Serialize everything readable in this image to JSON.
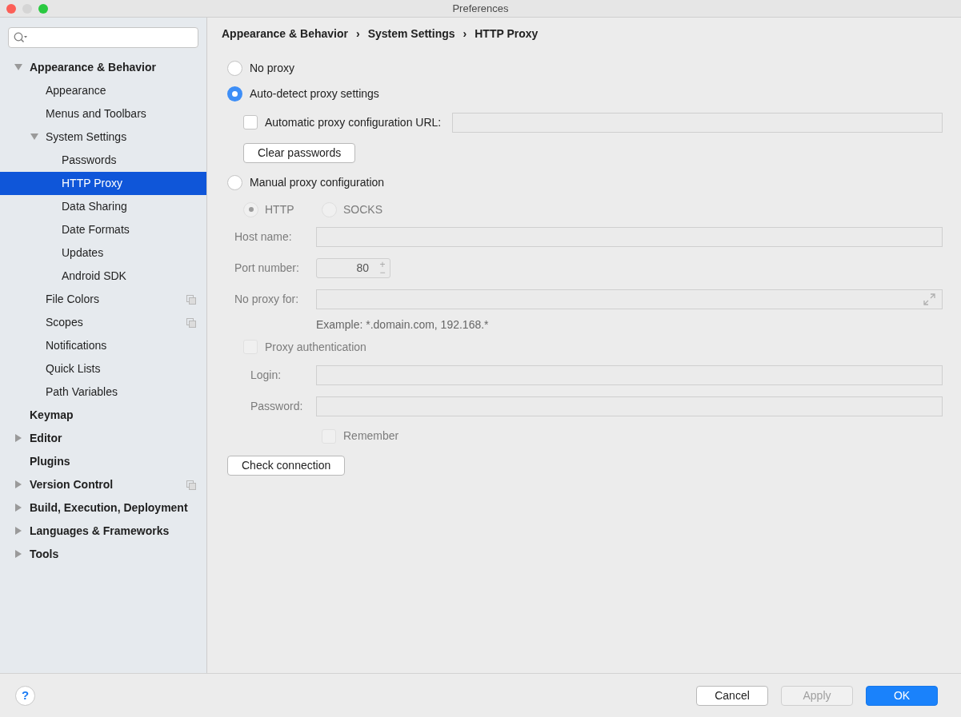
{
  "window": {
    "title": "Preferences"
  },
  "sidebar": {
    "items": [
      {
        "label": "Appearance & Behavior",
        "expanded": true,
        "selected": false,
        "shared": false,
        "children": [
          {
            "label": "Appearance",
            "selected": false,
            "shared": false
          },
          {
            "label": "Menus and Toolbars",
            "selected": false,
            "shared": false
          },
          {
            "label": "System Settings",
            "expanded": true,
            "selected": false,
            "shared": false,
            "children": [
              {
                "label": "Passwords",
                "selected": false,
                "shared": false
              },
              {
                "label": "HTTP Proxy",
                "selected": true,
                "shared": false
              },
              {
                "label": "Data Sharing",
                "selected": false,
                "shared": false
              },
              {
                "label": "Date Formats",
                "selected": false,
                "shared": false
              },
              {
                "label": "Updates",
                "selected": false,
                "shared": false
              },
              {
                "label": "Android SDK",
                "selected": false,
                "shared": false
              }
            ]
          },
          {
            "label": "File Colors",
            "selected": false,
            "shared": true
          },
          {
            "label": "Scopes",
            "selected": false,
            "shared": true
          },
          {
            "label": "Notifications",
            "selected": false,
            "shared": false
          },
          {
            "label": "Quick Lists",
            "selected": false,
            "shared": false
          },
          {
            "label": "Path Variables",
            "selected": false,
            "shared": false
          }
        ]
      },
      {
        "label": "Keymap",
        "selected": false,
        "shared": false
      },
      {
        "label": "Editor",
        "expanded": false,
        "selected": false,
        "shared": false
      },
      {
        "label": "Plugins",
        "selected": false,
        "shared": false
      },
      {
        "label": "Version Control",
        "expanded": false,
        "selected": false,
        "shared": true
      },
      {
        "label": "Build, Execution, Deployment",
        "expanded": false,
        "selected": false,
        "shared": false
      },
      {
        "label": "Languages & Frameworks",
        "expanded": false,
        "selected": false,
        "shared": false
      },
      {
        "label": "Tools",
        "expanded": false,
        "selected": false,
        "shared": false
      }
    ]
  },
  "breadcrumbs": [
    {
      "label": "Appearance & Behavior",
      "separator": "›"
    },
    {
      "label": "System Settings",
      "separator": "›"
    },
    {
      "label": "HTTP Proxy"
    }
  ],
  "proxy_modes": [
    {
      "label": "No proxy",
      "selected": false
    },
    {
      "label": "Auto-detect proxy settings",
      "selected": true
    },
    {
      "label": "Manual proxy configuration",
      "selected": false
    }
  ],
  "auto_config": {
    "label": "Automatic proxy configuration URL:",
    "checked": false
  },
  "clear_passwords_button": "Clear passwords",
  "manual": {
    "disabled": true,
    "protocols": [
      {
        "label": "HTTP",
        "selected": true
      },
      {
        "label": "SOCKS",
        "selected": false
      }
    ],
    "host_name": {
      "label": "Host name:"
    },
    "port_number": {
      "label": "Port number:",
      "value": "80",
      "stepper": [
        "+",
        "−"
      ]
    },
    "no_proxy_for": {
      "label": "No proxy for:"
    },
    "example": "Example: *.domain.com, 192.168.*",
    "proxy_authentication": {
      "label": "Proxy authentication",
      "checked": false
    },
    "login": {
      "label": "Login:"
    },
    "password": {
      "label": "Password:"
    },
    "remember": {
      "label": "Remember",
      "checked": false
    }
  },
  "check_connection_button": "Check connection",
  "footer": {
    "help": "?",
    "buttons": [
      {
        "label": "Cancel",
        "kind": "normal",
        "disabled": false
      },
      {
        "label": "Apply",
        "kind": "normal",
        "disabled": true
      },
      {
        "label": "OK",
        "kind": "default",
        "disabled": false
      }
    ]
  }
}
